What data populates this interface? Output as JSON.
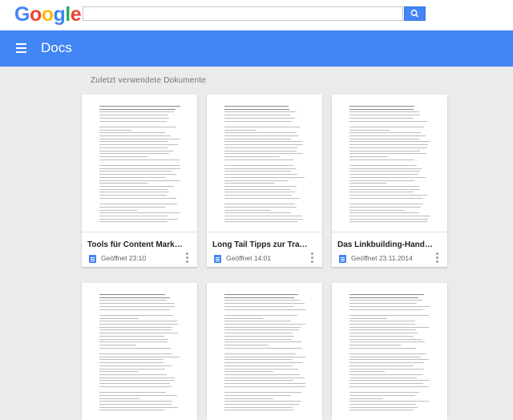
{
  "header": {
    "logo_letters": [
      {
        "ch": "G",
        "color": "#4285f4"
      },
      {
        "ch": "o",
        "color": "#ea4335"
      },
      {
        "ch": "o",
        "color": "#fbbc05"
      },
      {
        "ch": "g",
        "color": "#4285f4"
      },
      {
        "ch": "l",
        "color": "#34a853"
      },
      {
        "ch": "e",
        "color": "#ea4335"
      }
    ],
    "search": {
      "value": ""
    }
  },
  "appbar": {
    "title": "Docs",
    "color": "#4285f4"
  },
  "section_title": "Zuletzt verwendete Dokumente",
  "documents": [
    {
      "title": "Tools für Content Marketer",
      "meta": "Geöffnet 23:10",
      "preview_icon": "text-lines"
    },
    {
      "title": "Long Tail Tipps zur Traffic",
      "meta": "Geöffnet 14:01",
      "preview_icon": "text-lines"
    },
    {
      "title": "Das Linkbuilding-Handbuch",
      "meta": "Geöffnet 23.11.2014",
      "preview_icon": "text-lines"
    },
    {
      "title": "",
      "meta": "",
      "preview_icon": "text-lines"
    },
    {
      "title": "",
      "meta": "",
      "preview_icon": "text-lines"
    },
    {
      "title": "",
      "meta": "",
      "preview_icon": "text-lines"
    }
  ]
}
